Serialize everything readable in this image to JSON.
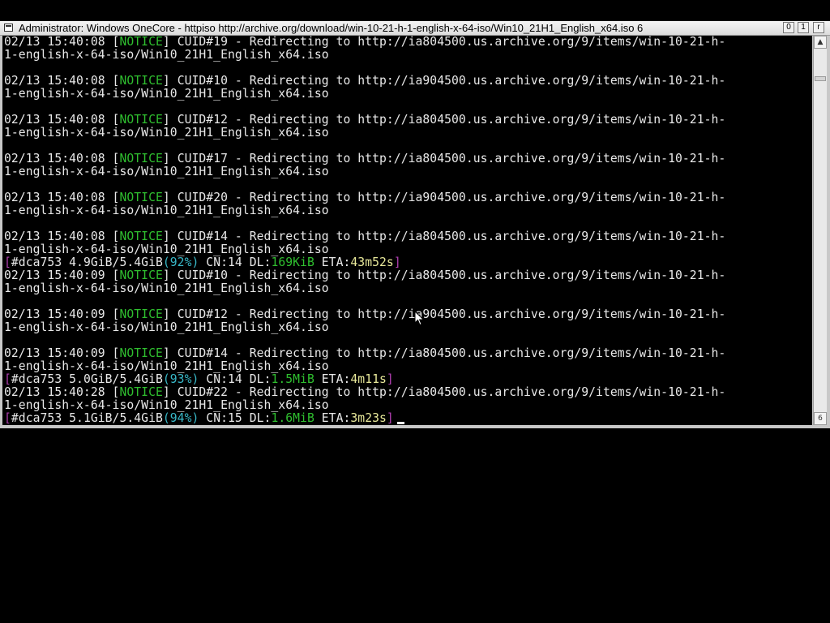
{
  "window": {
    "title": "Administrator:  Windows OneCore - httpiso  http://archive.org/download/win-10-21-h-1-english-x-64-iso/Win10_21H1_English_x64.iso 6",
    "controls": [
      "0",
      "1",
      "r"
    ]
  },
  "terminal": {
    "lines": [
      {
        "date": "02/13 15:40:08",
        "level": "NOTICE",
        "cuid": "CUID#19",
        "msg": "Redirecting to http://ia804500.us.archive.org/9/items/win-10-21-h-",
        "cont": "1-english-x-64-iso/Win10_21H1_English_x64.iso"
      },
      {
        "date": "02/13 15:40:08",
        "level": "NOTICE",
        "cuid": "CUID#10",
        "msg": "Redirecting to http://ia904500.us.archive.org/9/items/win-10-21-h-",
        "cont": "1-english-x-64-iso/Win10_21H1_English_x64.iso"
      },
      {
        "date": "02/13 15:40:08",
        "level": "NOTICE",
        "cuid": "CUID#12",
        "msg": "Redirecting to http://ia804500.us.archive.org/9/items/win-10-21-h-",
        "cont": "1-english-x-64-iso/Win10_21H1_English_x64.iso"
      },
      {
        "date": "02/13 15:40:08",
        "level": "NOTICE",
        "cuid": "CUID#17",
        "msg": "Redirecting to http://ia804500.us.archive.org/9/items/win-10-21-h-",
        "cont": "1-english-x-64-iso/Win10_21H1_English_x64.iso"
      },
      {
        "date": "02/13 15:40:08",
        "level": "NOTICE",
        "cuid": "CUID#20",
        "msg": "Redirecting to http://ia904500.us.archive.org/9/items/win-10-21-h-",
        "cont": "1-english-x-64-iso/Win10_21H1_English_x64.iso"
      },
      {
        "date": "02/13 15:40:08",
        "level": "NOTICE",
        "cuid": "CUID#14",
        "msg": "Redirecting to http://ia804500.us.archive.org/9/items/win-10-21-h-",
        "cont": "1-english-x-64-iso/Win10_21H1_English_x64.iso"
      },
      {
        "date": "02/13 15:40:09",
        "level": "NOTICE",
        "cuid": "CUID#10",
        "msg": "Redirecting to http://ia804500.us.archive.org/9/items/win-10-21-h-",
        "cont": "1-english-x-64-iso/Win10_21H1_English_x64.iso"
      },
      {
        "date": "02/13 15:40:09",
        "level": "NOTICE",
        "cuid": "CUID#12",
        "msg": "Redirecting to http://ia904500.us.archive.org/9/items/win-10-21-h-",
        "cont": "1-english-x-64-iso/Win10_21H1_English_x64.iso"
      },
      {
        "date": "02/13 15:40:09",
        "level": "NOTICE",
        "cuid": "CUID#14",
        "msg": "Redirecting to http://ia804500.us.archive.org/9/items/win-10-21-h-",
        "cont": "1-english-x-64-iso/Win10_21H1_English_x64.iso"
      },
      {
        "date": "02/13 15:40:28",
        "level": "NOTICE",
        "cuid": "CUID#22",
        "msg": "Redirecting to http://ia804500.us.archive.org/9/items/win-10-21-h-",
        "cont": "1-english-x-64-iso/Win10_21H1_English_x64.iso"
      }
    ],
    "progress": [
      {
        "gid": "#dca753",
        "size": "4.9GiB/5.4GiB",
        "pct": "(92%)",
        "cn": "CN:14",
        "dl_label": "DL:",
        "dl": "169KiB",
        "eta_label": "ETA:",
        "eta": "43m52s"
      },
      {
        "gid": "#dca753",
        "size": "5.0GiB/5.4GiB",
        "pct": "(93%)",
        "cn": "CN:14",
        "dl_label": "DL:",
        "dl": "1.5MiB",
        "eta_label": "ETA:",
        "eta": "4m11s"
      },
      {
        "gid": "#dca753",
        "size": "5.1GiB/5.4GiB",
        "pct": "(94%)",
        "cn": "CN:15",
        "dl_label": "DL:",
        "dl": "1.6MiB",
        "eta_label": "ETA:",
        "eta": "3m23s"
      }
    ]
  },
  "scrollbar": {
    "up_glyph": "▲",
    "down_glyph": "6"
  },
  "colors": {
    "notice": "#2fbf2f",
    "bracket": "#b03fb0",
    "percent": "#38b8c8",
    "download": "#2fbf2f",
    "eta": "#e8e89a"
  }
}
